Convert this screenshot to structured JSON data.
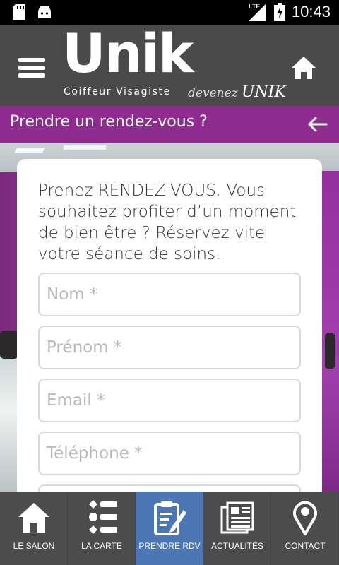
{
  "status_bar": {
    "network": "LTE",
    "time": "10:43",
    "icons": [
      "sd-card-icon",
      "android-icon",
      "signal-icon",
      "battery-icon"
    ]
  },
  "header": {
    "brand": "Unik",
    "tagline": "Coiffeur Visagiste",
    "tagline_script_prefix": "devenez",
    "tagline_script_brand": "UNIK",
    "menu_icon": "hamburger-menu-icon",
    "home_icon": "home-icon"
  },
  "title_bar": {
    "title": "Prendre un rendez-vous ?",
    "back_icon": "arrow-left-icon"
  },
  "form": {
    "intro": "Prenez RENDEZ-VOUS. Vous souhaitez profiter d’un moment de bien être ? Réservez vite votre séance de soins.",
    "fields": [
      {
        "placeholder": "Nom *",
        "value": ""
      },
      {
        "placeholder": "Prénom *",
        "value": ""
      },
      {
        "placeholder": "Email *",
        "value": ""
      },
      {
        "placeholder": "Téléphone *",
        "value": ""
      }
    ]
  },
  "bottom_nav": {
    "items": [
      {
        "label": "LE SALON",
        "icon": "home-icon",
        "active": false
      },
      {
        "label": "LA CARTE",
        "icon": "list-icon",
        "active": false
      },
      {
        "label": "PRENDRE RDV",
        "icon": "clipboard-edit-icon",
        "active": true
      },
      {
        "label": "ACTUALITÉS",
        "icon": "newspaper-icon",
        "active": false
      },
      {
        "label": "CONTACT",
        "icon": "map-pin-icon",
        "active": false
      }
    ]
  },
  "colors": {
    "header_bg": "#4a4a4a",
    "title_bar_bg": "#8f2c8f",
    "nav_bg": "#4c4c4c",
    "nav_active_bg": "#4b77b5"
  }
}
